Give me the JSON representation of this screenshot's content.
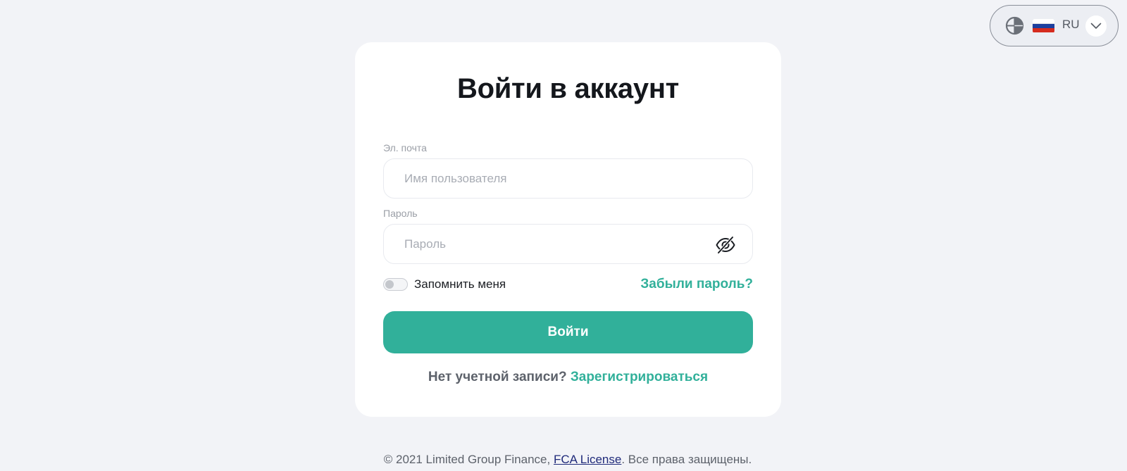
{
  "language": {
    "code": "RU",
    "flag_colors": [
      "#ffffff",
      "#1c3f9e",
      "#d52b1e"
    ]
  },
  "login": {
    "title": "Войти в аккаунт",
    "email_label": "Эл. почта",
    "email_placeholder": "Имя пользователя",
    "email_value": "",
    "password_label": "Пароль",
    "password_placeholder": "Пароль",
    "password_value": "",
    "remember_label": "Запомнить меня",
    "remember_checked": false,
    "forgot_link": "Забыли пароль?",
    "submit_label": "Войти",
    "no_account_text": "Нет учетной записи?",
    "register_link": "Зарегистрироваться"
  },
  "footer": {
    "copyright": "© 2021 Limited Group Finance, ",
    "license_link": "FCA License",
    "rights": ". Все права защищены."
  },
  "colors": {
    "accent": "#31b09a",
    "background": "#f2f3f7",
    "card": "#ffffff"
  },
  "icons": {
    "globe": "globe-icon",
    "flag": "russia-flag-icon",
    "chevron": "chevron-down-icon",
    "eye": "eye-off-icon"
  }
}
